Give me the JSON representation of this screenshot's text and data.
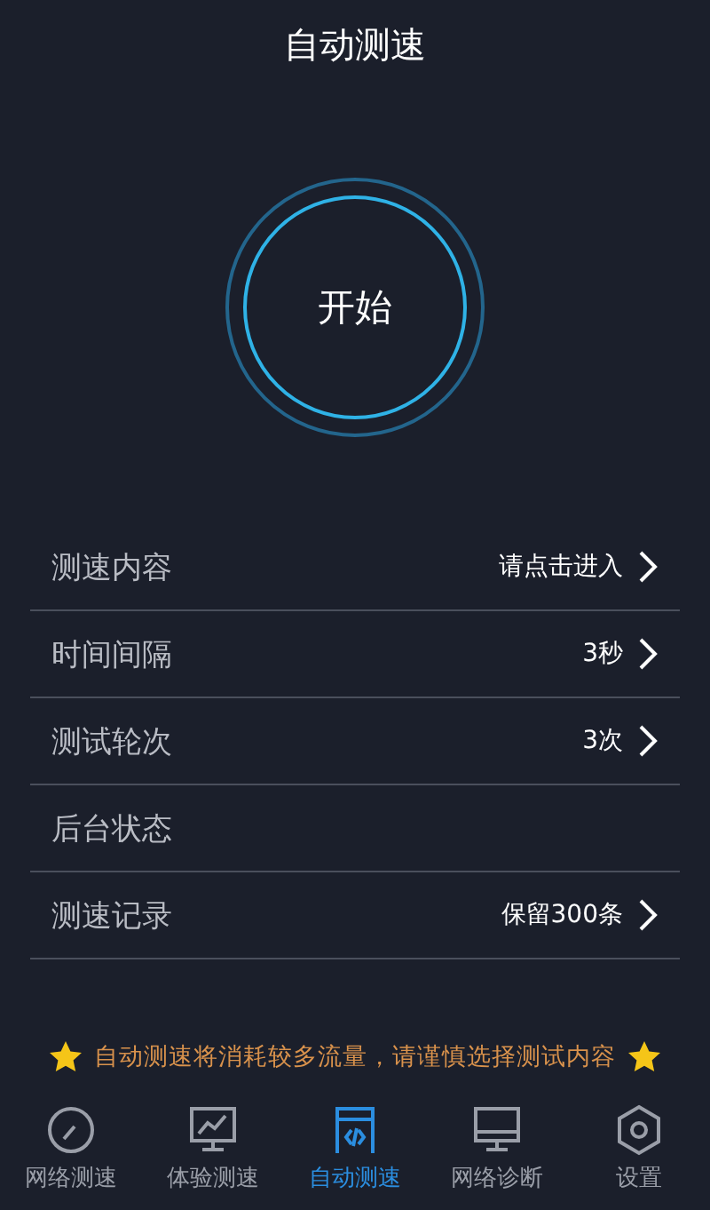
{
  "title": "自动测速",
  "start_button": {
    "label": "开始"
  },
  "settings": [
    {
      "label": "测速内容",
      "value": "请点击进入",
      "kind": "link"
    },
    {
      "label": "时间间隔",
      "value": "3秒",
      "kind": "link"
    },
    {
      "label": "测试轮次",
      "value": "3次",
      "kind": "link"
    },
    {
      "label": "后台状态",
      "kind": "plain"
    },
    {
      "label": "测速记录",
      "value": "保留300条",
      "kind": "link"
    }
  ],
  "notice": "自动测速将消耗较多流量，请谨慎选择测试内容",
  "tabs": [
    {
      "label": "网络测速",
      "kind": "gauge",
      "selected": false
    },
    {
      "label": "体验测速",
      "kind": "chart",
      "selected": false
    },
    {
      "label": "自动测速",
      "kind": "code",
      "selected": true
    },
    {
      "label": "网络诊断",
      "kind": "monitor",
      "selected": false
    },
    {
      "label": "设置",
      "kind": "hexagon",
      "selected": false
    }
  ]
}
